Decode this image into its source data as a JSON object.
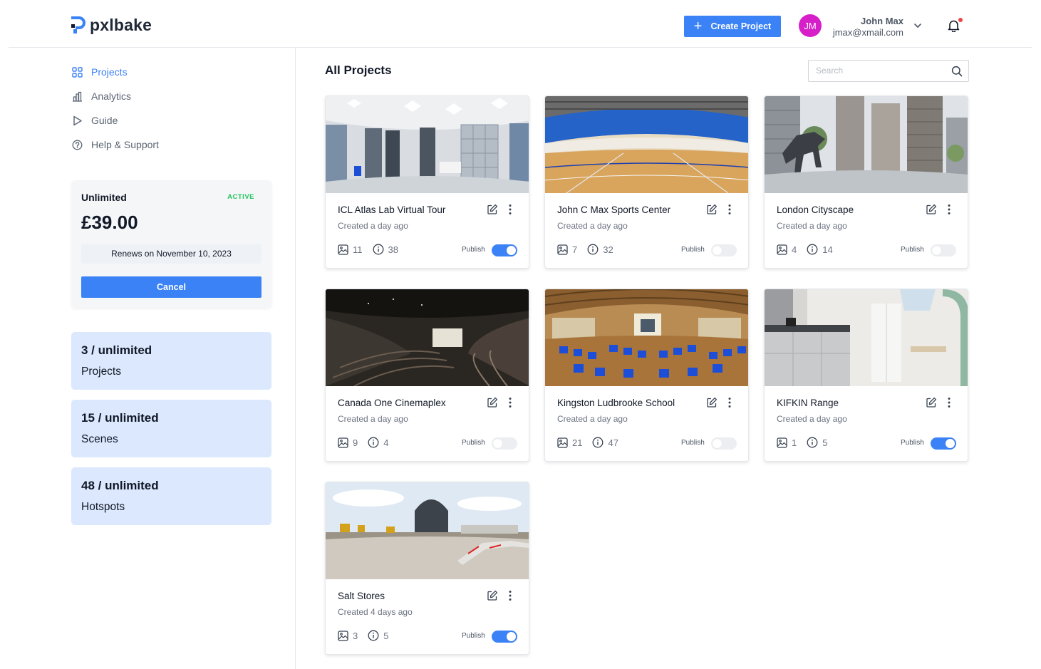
{
  "brand": {
    "name": "pxlbake",
    "accent": "#3b82f6"
  },
  "header": {
    "create_label": "Create Project",
    "avatar_initials": "JM",
    "user_name": "John Max",
    "user_email": "jmax@xmail.com"
  },
  "nav": [
    {
      "label": "Projects",
      "icon": "grid-icon",
      "active": true
    },
    {
      "label": "Analytics",
      "icon": "bar-chart-icon",
      "active": false
    },
    {
      "label": "Guide",
      "icon": "play-icon",
      "active": false
    },
    {
      "label": "Help & Support",
      "icon": "help-circle-icon",
      "active": false
    }
  ],
  "plan": {
    "name": "Unlimited",
    "status": "ACTIVE",
    "price": "£39.00",
    "renew": "Renews on November 10, 2023",
    "cancel_label": "Cancel"
  },
  "stats": [
    {
      "value": "3 / unlimited",
      "label": "Projects"
    },
    {
      "value": "15 / unlimited",
      "label": "Scenes"
    },
    {
      "value": "48 / unlimited",
      "label": "Hotspots"
    }
  ],
  "main": {
    "title": "All Projects",
    "search_placeholder": "Search"
  },
  "publish_label": "Publish",
  "projects": [
    {
      "title": "ICL Atlas Lab Virtual Tour",
      "created": "Created a day ago",
      "scenes": "11",
      "hotspots": "38",
      "published": true
    },
    {
      "title": "John C Max Sports Center",
      "created": "Created a day ago",
      "scenes": "7",
      "hotspots": "32",
      "published": false
    },
    {
      "title": "London Cityscape",
      "created": "Created a day ago",
      "scenes": "4",
      "hotspots": "14",
      "published": false
    },
    {
      "title": "Canada One Cinemaplex",
      "created": "Created a day ago",
      "scenes": "9",
      "hotspots": "4",
      "published": false
    },
    {
      "title": "Kingston Ludbrooke School",
      "created": "Created a day ago",
      "scenes": "21",
      "hotspots": "47",
      "published": false
    },
    {
      "title": "KIFKIN Range",
      "created": "Created a day ago",
      "scenes": "1",
      "hotspots": "5",
      "published": true
    },
    {
      "title": "Salt Stores",
      "created": "Created 4 days ago",
      "scenes": "3",
      "hotspots": "5",
      "published": true
    }
  ]
}
